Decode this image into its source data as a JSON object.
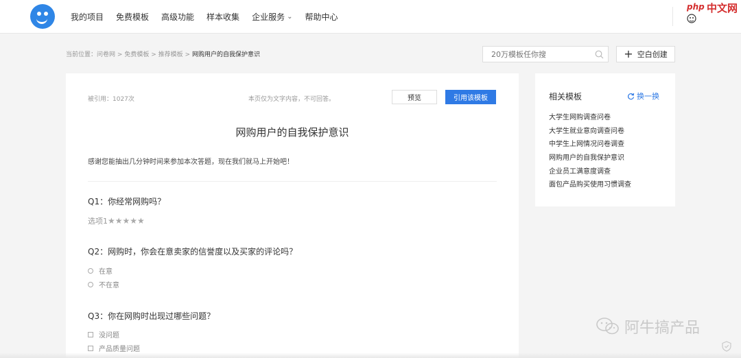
{
  "nav": {
    "items": [
      "我的项目",
      "免费模板",
      "高级功能",
      "样本收集",
      "企业服务",
      "帮助中心"
    ]
  },
  "watermark_top": {
    "php": "php",
    "text": "中文网"
  },
  "breadcrumb": {
    "prefix": "当前位置：",
    "items": [
      "问卷网",
      "免费模板",
      "推荐模板"
    ],
    "sep": ">",
    "current": "网购用户的自我保护意识"
  },
  "search": {
    "placeholder": "20万模板任你搜"
  },
  "new_button": {
    "label": "空白创建"
  },
  "survey": {
    "cited": "被引用：1027次",
    "text_only": "本页仅为文字内容，不可回答。",
    "preview_label": "预览",
    "use_label": "引用该模板",
    "title": "网购用户的自我保护意识",
    "intro": "感谢您能抽出几分钟时间来参加本次答题，现在我们就马上开始吧！",
    "q1": {
      "text": "Q1：你经常网购吗？",
      "option_label": "选项1",
      "stars": "★★★★★"
    },
    "q2": {
      "text": "Q2：网购时，你会在意卖家的信誉度以及买家的评论吗？",
      "options": [
        "在意",
        "不在意"
      ]
    },
    "q3": {
      "text": "Q3：你在网购时出现过哪些问题？",
      "options": [
        "没问题",
        "产品质量问题"
      ]
    }
  },
  "related": {
    "title": "相关模板",
    "refresh_label": "换一换",
    "items": [
      "大学生网购调查问卷",
      "大学生就业意向调查问卷",
      "中学生上网情况问卷调查",
      "网购用户的自我保护意识",
      "企业员工满意度调查",
      "面包产品购买使用习惯调查"
    ]
  },
  "watermark_bottom": {
    "text": "阿牛搞产品"
  },
  "colors": {
    "accent": "#2f7ae5",
    "logo": "#2f86e6"
  }
}
